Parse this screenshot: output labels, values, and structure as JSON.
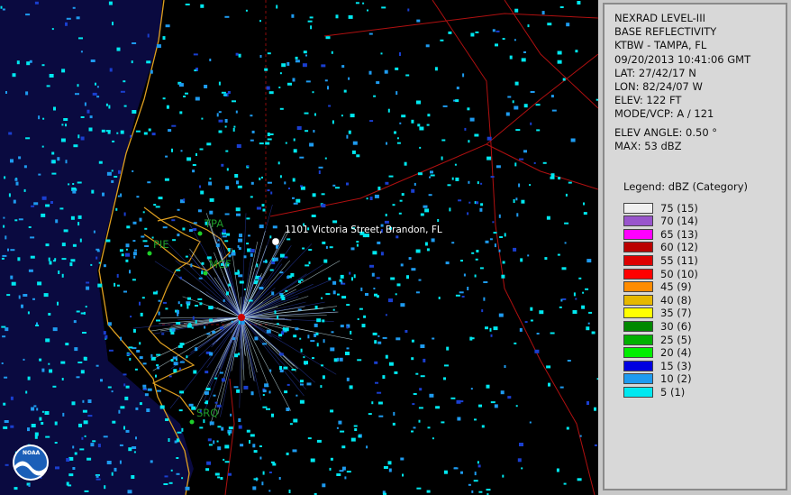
{
  "info": {
    "lines": [
      "NEXRAD LEVEL-III",
      "BASE REFLECTIVITY",
      "KTBW - TAMPA, FL",
      "09/20/2013 10:41:06 GMT",
      "LAT: 27/42/17 N",
      "LON: 82/24/07 W",
      "ELEV: 122 FT",
      "MODE/VCP: A / 121"
    ],
    "elev_angle": "ELEV ANGLE: 0.50 °",
    "max": "MAX: 53 dBZ"
  },
  "legend": {
    "title": "Legend: dBZ (Category)",
    "items": [
      {
        "label": "75  (15)",
        "color": "#f0f0f0"
      },
      {
        "label": "70  (14)",
        "color": "#9955cc"
      },
      {
        "label": "65  (13)",
        "color": "#ff00ff"
      },
      {
        "label": "60  (12)",
        "color": "#bb0000"
      },
      {
        "label": "55  (11)",
        "color": "#dd0000"
      },
      {
        "label": "50  (10)",
        "color": "#ff0000"
      },
      {
        "label": "45  (9)",
        "color": "#ff8c00"
      },
      {
        "label": "40  (8)",
        "color": "#e6b800"
      },
      {
        "label": "35  (7)",
        "color": "#ffff00"
      },
      {
        "label": "30  (6)",
        "color": "#008800"
      },
      {
        "label": "25  (5)",
        "color": "#00b000"
      },
      {
        "label": "20  (4)",
        "color": "#00ee00"
      },
      {
        "label": "15  (3)",
        "color": "#0000e0"
      },
      {
        "label": "10  (2)",
        "color": "#1e9bf0"
      },
      {
        "label": "5  (1)",
        "color": "#00e8f0"
      }
    ]
  },
  "map": {
    "cities": [
      "TPA",
      "PIE",
      "MCF",
      "SRQ"
    ],
    "location_label": "1101 Victoria Street, Brandon, FL",
    "logo_text": "NOAA",
    "colors": {
      "water": "#0a0a40",
      "coast": "#e0a020",
      "roads": "#b01010",
      "echo_light": "#00e8f0",
      "echo_med": "#1e9bf0",
      "echo_dark": "#1a3fd0"
    }
  }
}
